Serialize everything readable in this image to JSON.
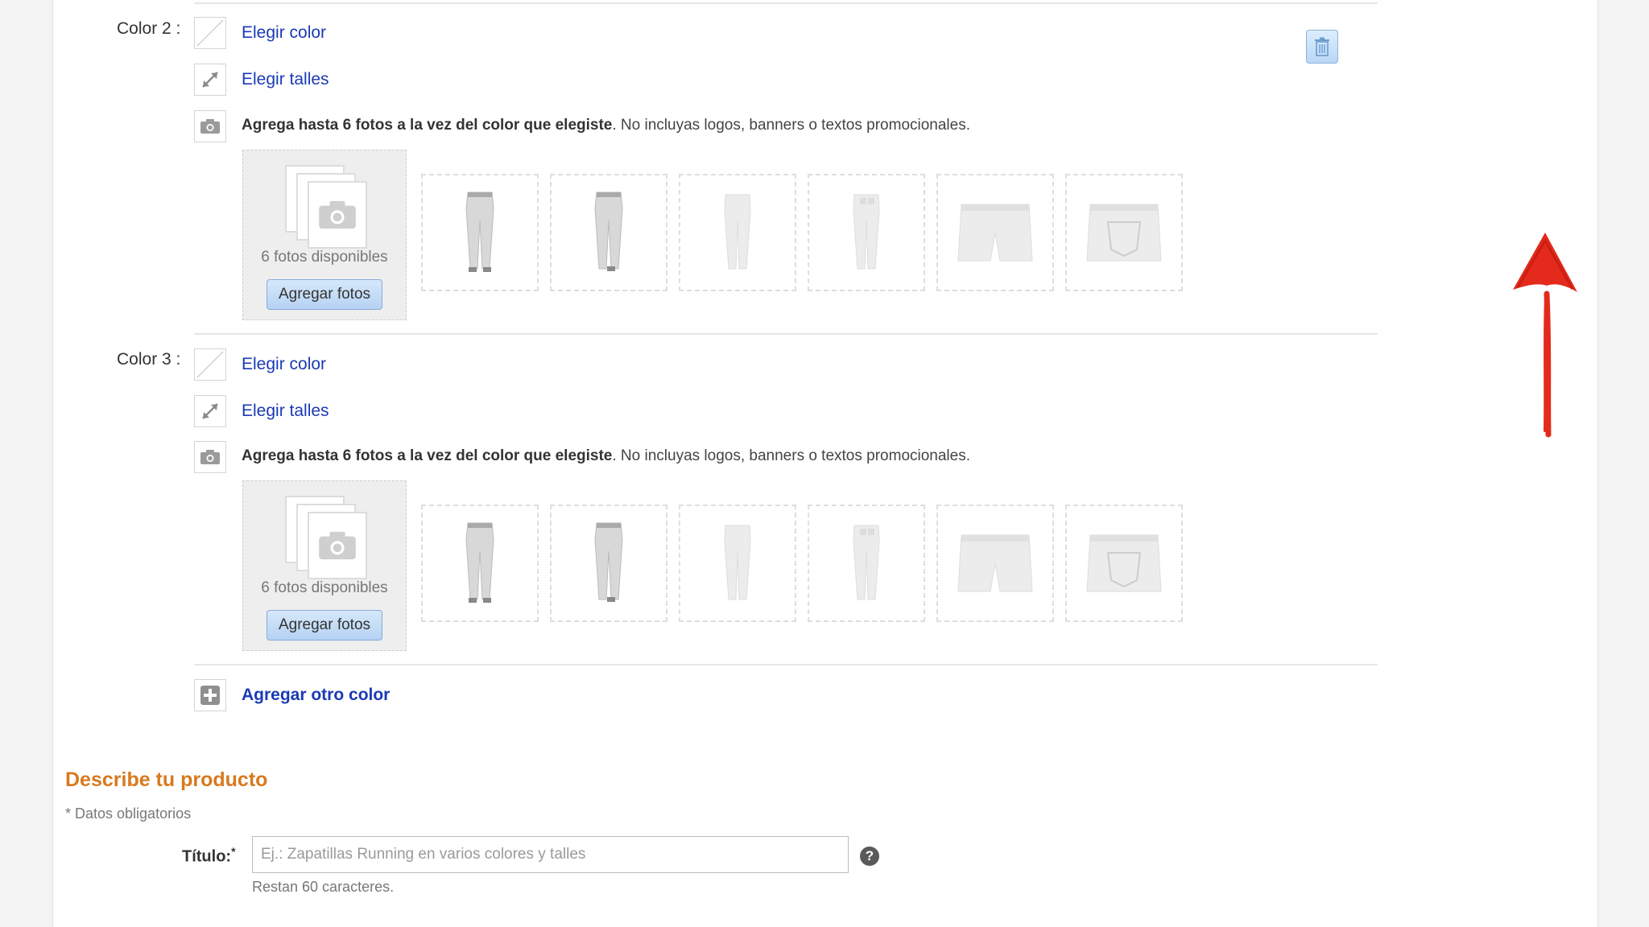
{
  "colors": [
    {
      "label": "Color 2 :",
      "choose_color": "Elegir color",
      "choose_sizes": "Elegir talles",
      "photo_hint_bold": "Agrega hasta 6 fotos a la vez del color que elegiste",
      "photo_hint_rest": ". No incluyas logos, banners o textos promocionales.",
      "photos_available": "6 fotos disponibles",
      "add_photos": "Agregar fotos"
    },
    {
      "label": "Color 3 :",
      "choose_color": "Elegir color",
      "choose_sizes": "Elegir talles",
      "photo_hint_bold": "Agrega hasta 6 fotos a la vez del color que elegiste",
      "photo_hint_rest": ". No incluyas logos, banners o textos promocionales.",
      "photos_available": "6 fotos disponibles",
      "add_photos": "Agregar fotos"
    }
  ],
  "add_color": "Agregar otro color",
  "describe": {
    "title": "Describe tu producto",
    "required_note": "* Datos obligatorios",
    "title_label": "Título:",
    "required_mark": "*",
    "title_placeholder": "Ej.: Zapatillas Running en varios colores y talles",
    "chars_left": "Restan 60 caracteres.",
    "help": "?"
  },
  "icons": [
    "color-swatch-icon",
    "resize-icon",
    "camera-icon",
    "trash-icon",
    "plus-icon",
    "help-icon"
  ],
  "colors_palette": {
    "link": "#1a3ab5",
    "section_title": "#d77a1f",
    "annotation": "#e32a1c"
  }
}
